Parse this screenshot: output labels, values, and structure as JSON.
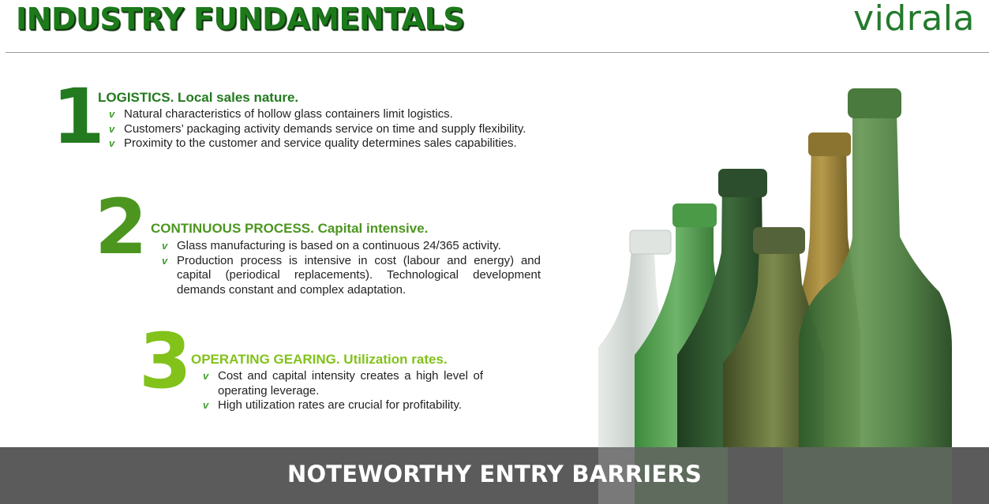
{
  "header": {
    "title": "INDUSTRY FUNDAMENTALS",
    "logo": "vidrala"
  },
  "sections": [
    {
      "number": "1",
      "heading": "LOGISTICS. Local sales nature.",
      "bullets": [
        "Natural characteristics of hollow glass containers limit logistics.",
        "Customers’ packaging activity demands service on time and supply flexibility.",
        "Proximity to the customer and service quality determines sales capabilities."
      ]
    },
    {
      "number": "2",
      "heading": "CONTINUOUS PROCESS. Capital intensive.",
      "bullets": [
        "Glass manufacturing is based on a continuous 24/365 activity.",
        "Production process is intensive in cost (labour and energy) and capital (periodical replacements). Technological development demands constant and complex adaptation."
      ]
    },
    {
      "number": "3",
      "heading": "OPERATING GEARING. Utilization rates.",
      "bullets": [
        "Cost and capital intensity creates a high level of operating leverage.",
        "High utilization rates are crucial for profitability."
      ]
    }
  ],
  "bullet_icon": "check-mark-icon",
  "banner": {
    "text": "NOTEWORTHY ENTRY BARRIERS"
  },
  "colors": {
    "dark_green": "#237a1f",
    "mid_green": "#4c9620",
    "light_green": "#82c21b",
    "banner": "#5b5b5b"
  }
}
